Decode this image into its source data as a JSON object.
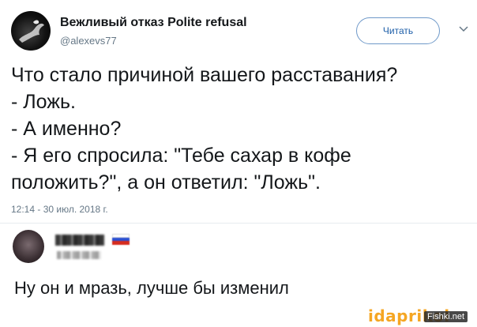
{
  "account": {
    "name": "Вежливый отказ Polite refusal",
    "handle": "@alexevs77"
  },
  "follow_button": {
    "label": "Читать"
  },
  "more_icon": "chevron-down-icon",
  "tweet": {
    "lines": [
      "Что стало причиной вашего расставания?",
      "- Ложь.",
      "- А именно?",
      "- Я его спросила: \"Тебе сахар в кофе",
      "положить?\", а он ответил: \"Ложь\"."
    ],
    "timestamp": "12:14 - 30 июл. 2018 г."
  },
  "reply": {
    "flag_colors": [
      "#ffffff",
      "#2b4fd1",
      "#d52b1e"
    ],
    "text": "Ну он и мразь, лучше бы изменил"
  },
  "watermarks": {
    "site": "idaprikol",
    "source": "Fishki.net"
  },
  "colors": {
    "link_blue": "#1d5ea8",
    "muted_gray": "#657786",
    "watermark_orange": "#f5a623"
  }
}
